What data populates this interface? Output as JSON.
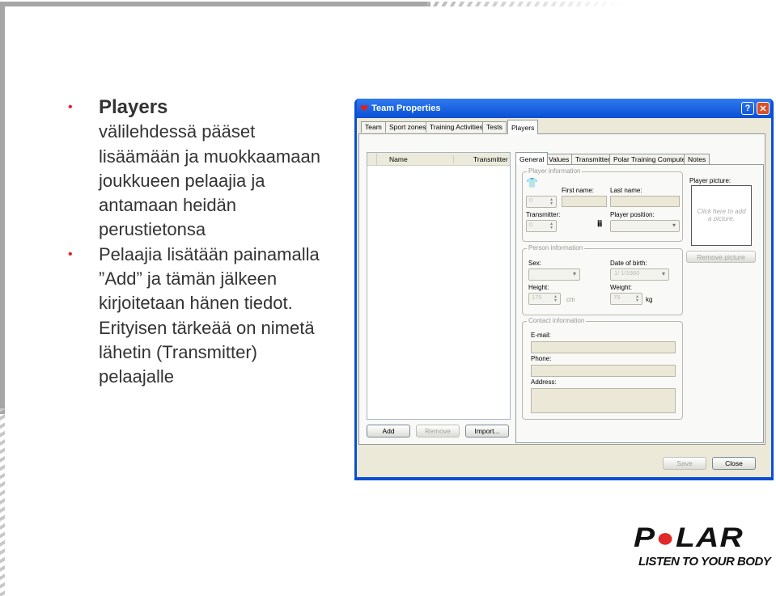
{
  "slide": {
    "bullets": [
      {
        "title": "Players",
        "text": "välilehdessä pääset lisäämään ja muokkaamaan joukkueen pelaajia ja antamaan heidän perustietonsa"
      },
      {
        "text": "Pelaajia lisätään painamalla ”Add” ja tämän jälkeen kirjoitetaan hänen tiedot. Erityisen tärkeää on nimetä lähetin (Transmitter) pelaajalle"
      }
    ],
    "logo": {
      "brand": "POLAR",
      "tagline": "LISTEN TO YOUR BODY"
    }
  },
  "dialog": {
    "title": "Team Properties",
    "help": "?",
    "close": "✕",
    "tabs": [
      "Team",
      "Sport zones",
      "Training Activities",
      "Tests",
      "Players"
    ],
    "list": {
      "col_name": "Name",
      "col_transmitter": "Transmitter"
    },
    "list_buttons": {
      "add": "Add",
      "remove": "Remove",
      "import": "Import..."
    },
    "subtabs": [
      "General",
      "Values",
      "Transmitter",
      "Polar Training Computer",
      "Notes"
    ],
    "player_info": {
      "legend": "Player information",
      "first_name": "First name:",
      "last_name": "Last name:",
      "transmitter": "Transmitter:",
      "position": "Player position:",
      "number_value": "0",
      "transmitter_value": "0"
    },
    "picture": {
      "label": "Player picture:",
      "hint": "Click here to add a picture.",
      "remove": "Remove picture"
    },
    "person_info": {
      "legend": "Person information",
      "sex": "Sex:",
      "dob": "Date of birth:",
      "dob_value": "1/ 1/1980",
      "height": "Height:",
      "height_value": "175",
      "height_unit": "cm",
      "weight": "Weight:",
      "weight_value": "75",
      "weight_unit": "kg"
    },
    "contact_info": {
      "legend": "Contact information",
      "email": "E-mail:",
      "phone": "Phone:",
      "address": "Address:"
    },
    "footer": {
      "save": "Save",
      "close": "Close"
    }
  }
}
